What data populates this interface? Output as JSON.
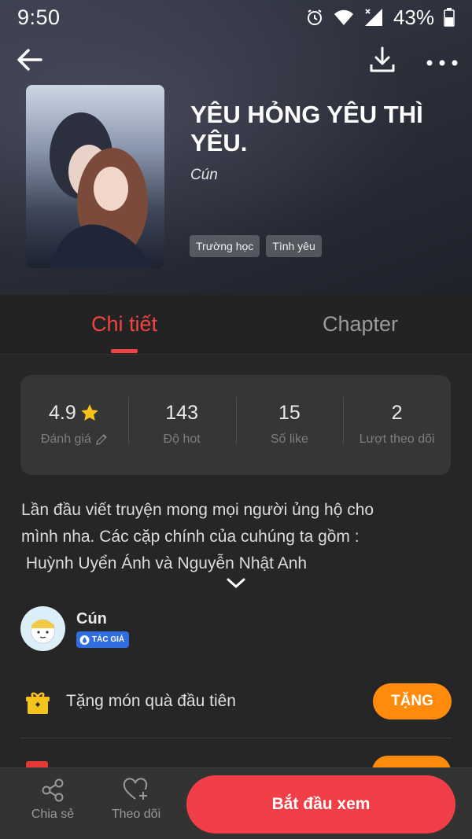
{
  "status_bar": {
    "time": "9:50",
    "battery": "43%"
  },
  "story": {
    "title": "YÊU HỎNG YÊU THÌ YÊU.",
    "author": "Cún",
    "tags": [
      "Trường học",
      "Tình yêu"
    ]
  },
  "tabs": [
    {
      "label": "Chi tiết",
      "active": true
    },
    {
      "label": "Chapter",
      "active": false
    }
  ],
  "stats": [
    {
      "value": "4.9",
      "label": "Đánh giá"
    },
    {
      "value": "143",
      "label": "Độ hot"
    },
    {
      "value": "15",
      "label": "Số like"
    },
    {
      "value": "2",
      "label": "Lượt theo dõi"
    }
  ],
  "description": {
    "line1": "Lần đầu viết truyện mong mọi người ủng hộ cho",
    "line2": "mình nha. Các cặp chính của cuhúng ta gồm :",
    "line3": " Huỳnh Uyển Ánh và Nguyễn Nhật Anh"
  },
  "author_card": {
    "name": "Cún",
    "badge": "TÁC GIẢ"
  },
  "gift": {
    "text": "Tặng món quà đầu tiên",
    "button": "TẶNG"
  },
  "bottom_bar": {
    "share": "Chia sẻ",
    "follow": "Theo dõi",
    "start": "Bắt đầu xem"
  },
  "colors": {
    "accent_red": "#f04444",
    "orange": "#ff8a0b",
    "badge_blue": "#2f6de0"
  }
}
